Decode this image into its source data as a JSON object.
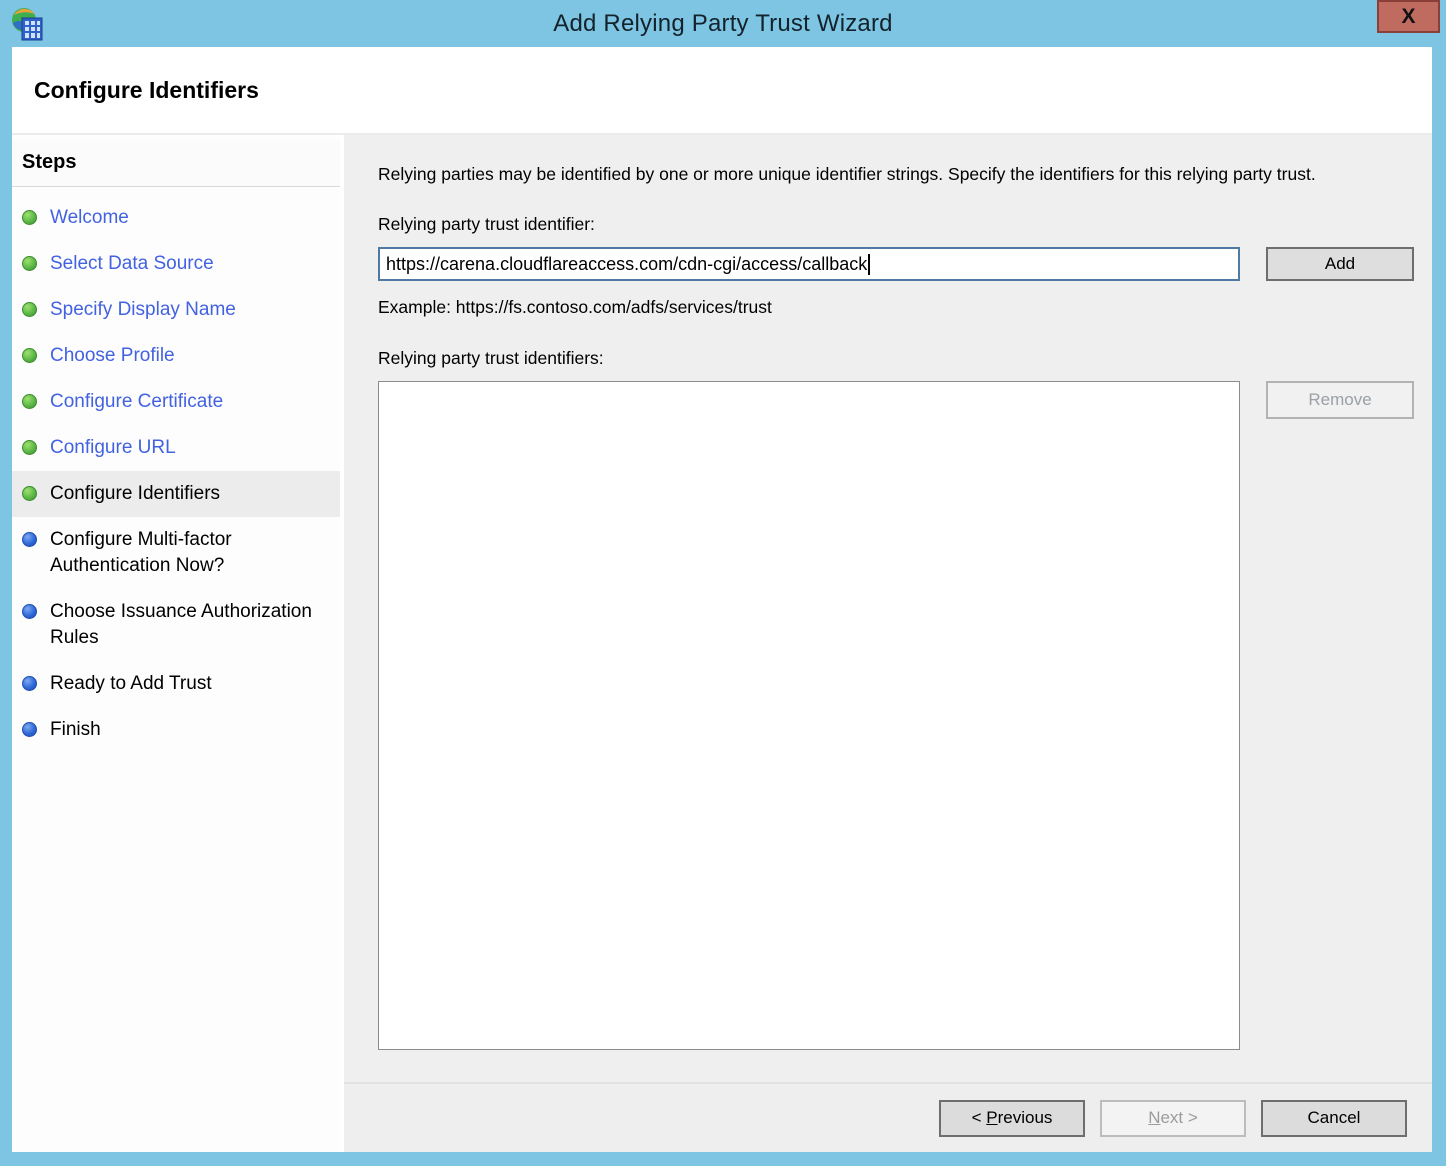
{
  "window": {
    "title": "Add Relying Party Trust Wizard",
    "close_label": "X"
  },
  "page": {
    "heading": "Configure Identifiers"
  },
  "sidebar": {
    "heading": "Steps",
    "steps": [
      {
        "label": "Welcome",
        "state": "completed"
      },
      {
        "label": "Select Data Source",
        "state": "completed"
      },
      {
        "label": "Specify Display Name",
        "state": "completed"
      },
      {
        "label": "Choose Profile",
        "state": "completed"
      },
      {
        "label": "Configure Certificate",
        "state": "completed"
      },
      {
        "label": "Configure URL",
        "state": "completed"
      },
      {
        "label": "Configure Identifiers",
        "state": "current"
      },
      {
        "label": "Configure Multi-factor Authentication Now?",
        "state": "upcoming"
      },
      {
        "label": "Choose Issuance Authorization Rules",
        "state": "upcoming"
      },
      {
        "label": "Ready to Add Trust",
        "state": "upcoming"
      },
      {
        "label": "Finish",
        "state": "upcoming"
      }
    ]
  },
  "main": {
    "instruction": "Relying parties may be identified by one or more unique identifier strings. Specify the identifiers for this relying party trust.",
    "identifier_label": "Relying party trust identifier:",
    "identifier_value": "https://carena.cloudflareaccess.com/cdn-cgi/access/callback",
    "add_button": "Add",
    "example": "Example: https://fs.contoso.com/adfs/services/trust",
    "identifiers_list_label": "Relying party trust identifiers:",
    "identifiers_list_items": [],
    "remove_button": "Remove"
  },
  "footer": {
    "previous": {
      "pre": "< ",
      "accel": "P",
      "post": "revious"
    },
    "next": {
      "accel": "N",
      "post": "ext >"
    },
    "cancel": "Cancel"
  },
  "colors": {
    "titlebar_blue": "#7dc5e3",
    "close_button_red": "#bf6b5f",
    "link_blue": "#4262e0",
    "completed_bullet_green": "#5cb947",
    "upcoming_bullet_blue": "#2f6ad9",
    "current_step_bg": "#ececec",
    "main_pane_bg": "#efefef",
    "input_focus_border": "#4f7aa2"
  }
}
